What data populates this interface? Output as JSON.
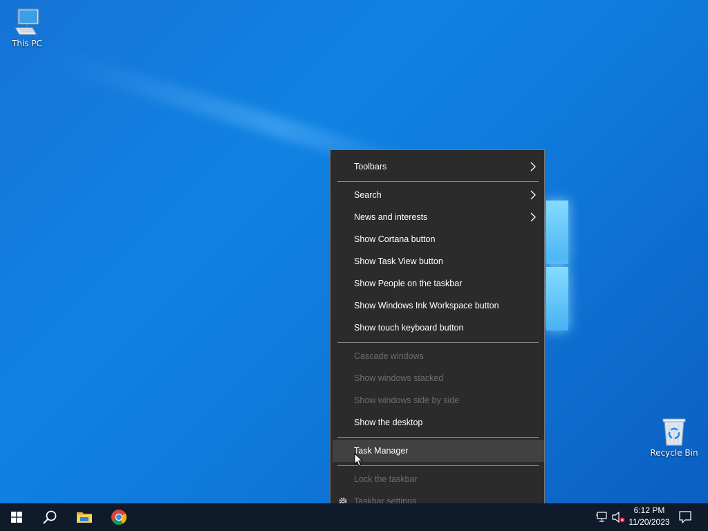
{
  "desktop": {
    "icons": [
      {
        "label": "This PC",
        "icon": "this-pc-icon"
      },
      {
        "label": "Recycle Bin",
        "icon": "recycle-bin-icon"
      }
    ]
  },
  "context_menu": {
    "items": [
      {
        "label": "Toolbars",
        "enabled": true,
        "submenu": true
      },
      {
        "label": "Search",
        "enabled": true,
        "submenu": true
      },
      {
        "label": "News and interests",
        "enabled": true,
        "submenu": true
      },
      {
        "label": "Show Cortana button",
        "enabled": true
      },
      {
        "label": "Show Task View button",
        "enabled": true
      },
      {
        "label": "Show People on the taskbar",
        "enabled": true
      },
      {
        "label": "Show Windows Ink Workspace button",
        "enabled": true
      },
      {
        "label": "Show touch keyboard button",
        "enabled": true
      },
      {
        "label": "Cascade windows",
        "enabled": false
      },
      {
        "label": "Show windows stacked",
        "enabled": false
      },
      {
        "label": "Show windows side by side",
        "enabled": false
      },
      {
        "label": "Show the desktop",
        "enabled": true
      },
      {
        "label": "Task Manager",
        "enabled": true,
        "hovered": true
      },
      {
        "label": "Lock the taskbar",
        "enabled": false
      },
      {
        "label": "Taskbar settings",
        "enabled": false,
        "icon": "gear-icon"
      }
    ]
  },
  "taskbar": {
    "pinned": [
      {
        "icon": "windows-start-icon"
      },
      {
        "icon": "search-icon"
      },
      {
        "icon": "file-explorer-icon"
      },
      {
        "icon": "chrome-icon"
      }
    ],
    "tray": {
      "icons": [
        "network-icon",
        "volume-muted-icon",
        "notification-icon"
      ],
      "time": "6:12 PM",
      "date": "11/20/2023"
    }
  },
  "colors": {
    "desktop_blue": "#0f78d9",
    "taskbar": "#0f1b2a",
    "menu_bg": "#2b2b2b",
    "menu_hover": "#414141",
    "menu_disabled_text": "#6d6d6d"
  }
}
